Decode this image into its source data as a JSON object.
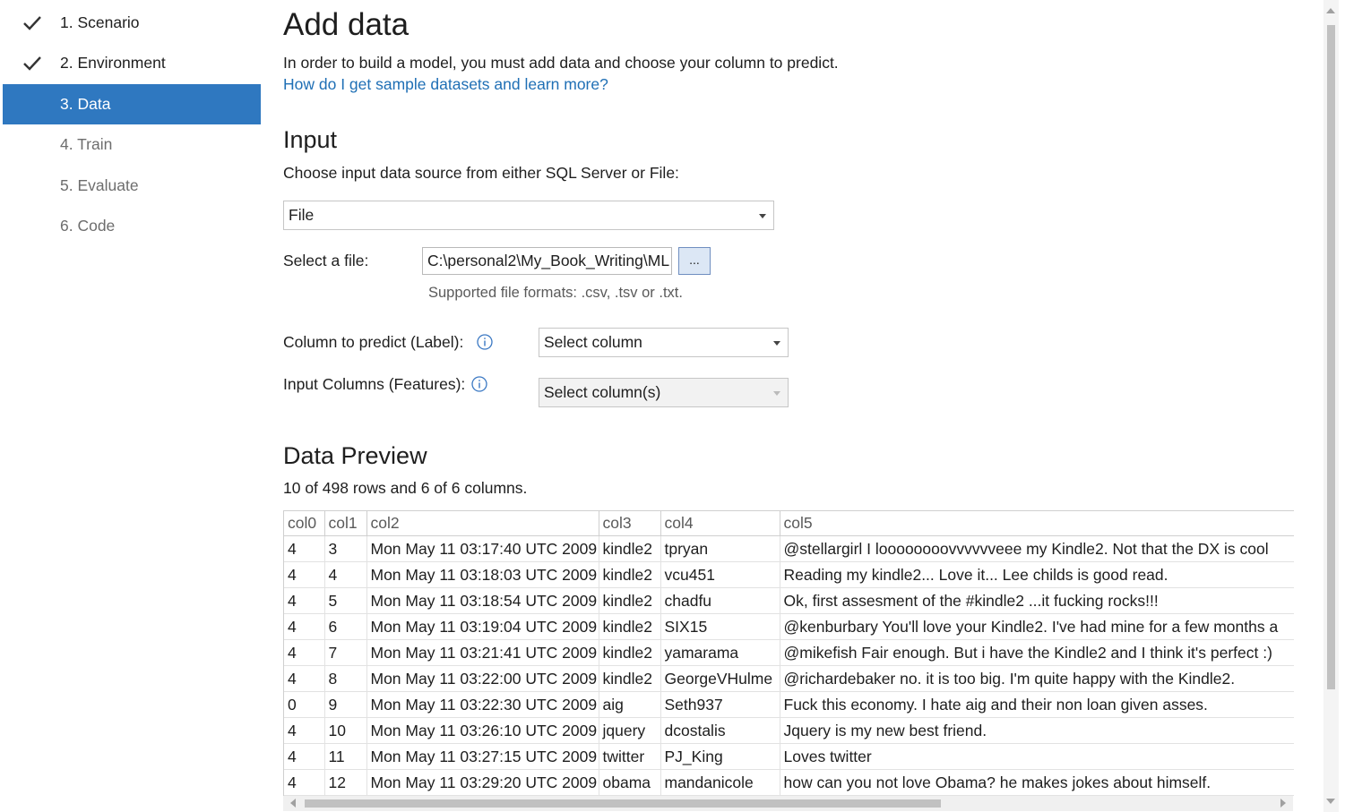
{
  "sidebar": {
    "steps": [
      {
        "label": "1. Scenario",
        "state": "done"
      },
      {
        "label": "2. Environment",
        "state": "done"
      },
      {
        "label": "3. Data",
        "state": "active"
      },
      {
        "label": "4. Train",
        "state": "todo"
      },
      {
        "label": "5. Evaluate",
        "state": "todo"
      },
      {
        "label": "6. Code",
        "state": "todo"
      }
    ]
  },
  "header": {
    "title": "Add data",
    "intro": "In order to build a model, you must add data and choose your column to predict.",
    "help_link": "How do I get sample datasets and learn more?"
  },
  "input": {
    "title": "Input",
    "description": "Choose input data source from either SQL Server or File:",
    "source_value": "File",
    "file_label": "Select a file:",
    "file_path": "C:\\personal2\\My_Book_Writing\\ML",
    "browse_label": "...",
    "supported_formats": "Supported file formats: .csv, .tsv or .txt.",
    "label_column_text": "Column to predict (Label):",
    "label_column_value": "Select column",
    "features_text": "Input Columns (Features):",
    "features_value": "Select column(s)"
  },
  "preview": {
    "title": "Data Preview",
    "summary": "10 of 498 rows and 6 of 6 columns.",
    "columns": [
      "col0",
      "col1",
      "col2",
      "col3",
      "col4",
      "col5"
    ],
    "rows": [
      [
        "4",
        "3",
        "Mon May 11 03:17:40 UTC 2009",
        "kindle2",
        "tpryan",
        "@stellargirl I loooooooovvvvvveee my Kindle2. Not that the DX is cool"
      ],
      [
        "4",
        "4",
        "Mon May 11 03:18:03 UTC 2009",
        "kindle2",
        "vcu451",
        "Reading my kindle2...  Love it... Lee childs is good read."
      ],
      [
        "4",
        "5",
        "Mon May 11 03:18:54 UTC 2009",
        "kindle2",
        "chadfu",
        "Ok, first assesment of the #kindle2 ...it fucking rocks!!!"
      ],
      [
        "4",
        "6",
        "Mon May 11 03:19:04 UTC 2009",
        "kindle2",
        "SIX15",
        "@kenburbary You'll love your Kindle2. I've had mine for a few months a"
      ],
      [
        "4",
        "7",
        "Mon May 11 03:21:41 UTC 2009",
        "kindle2",
        "yamarama",
        "@mikefish  Fair enough. But i have the Kindle2 and I think it's perfect  :)"
      ],
      [
        "4",
        "8",
        "Mon May 11 03:22:00 UTC 2009",
        "kindle2",
        "GeorgeVHulme",
        "@richardebaker no. it is too big. I'm quite happy with the Kindle2."
      ],
      [
        "0",
        "9",
        "Mon May 11 03:22:30 UTC 2009",
        "aig",
        "Seth937",
        "Fuck this economy. I hate aig and their non loan given asses."
      ],
      [
        "4",
        "10",
        "Mon May 11 03:26:10 UTC 2009",
        "jquery",
        "dcostalis",
        "Jquery is my new best friend."
      ],
      [
        "4",
        "11",
        "Mon May 11 03:27:15 UTC 2009",
        "twitter",
        "PJ_King",
        "Loves twitter"
      ],
      [
        "4",
        "12",
        "Mon May 11 03:29:20 UTC 2009",
        "obama",
        "mandanicole",
        "how can you not love Obama? he makes jokes about himself."
      ]
    ]
  },
  "colors": {
    "accent": "#2f78c0",
    "link": "#1f6fb5"
  }
}
